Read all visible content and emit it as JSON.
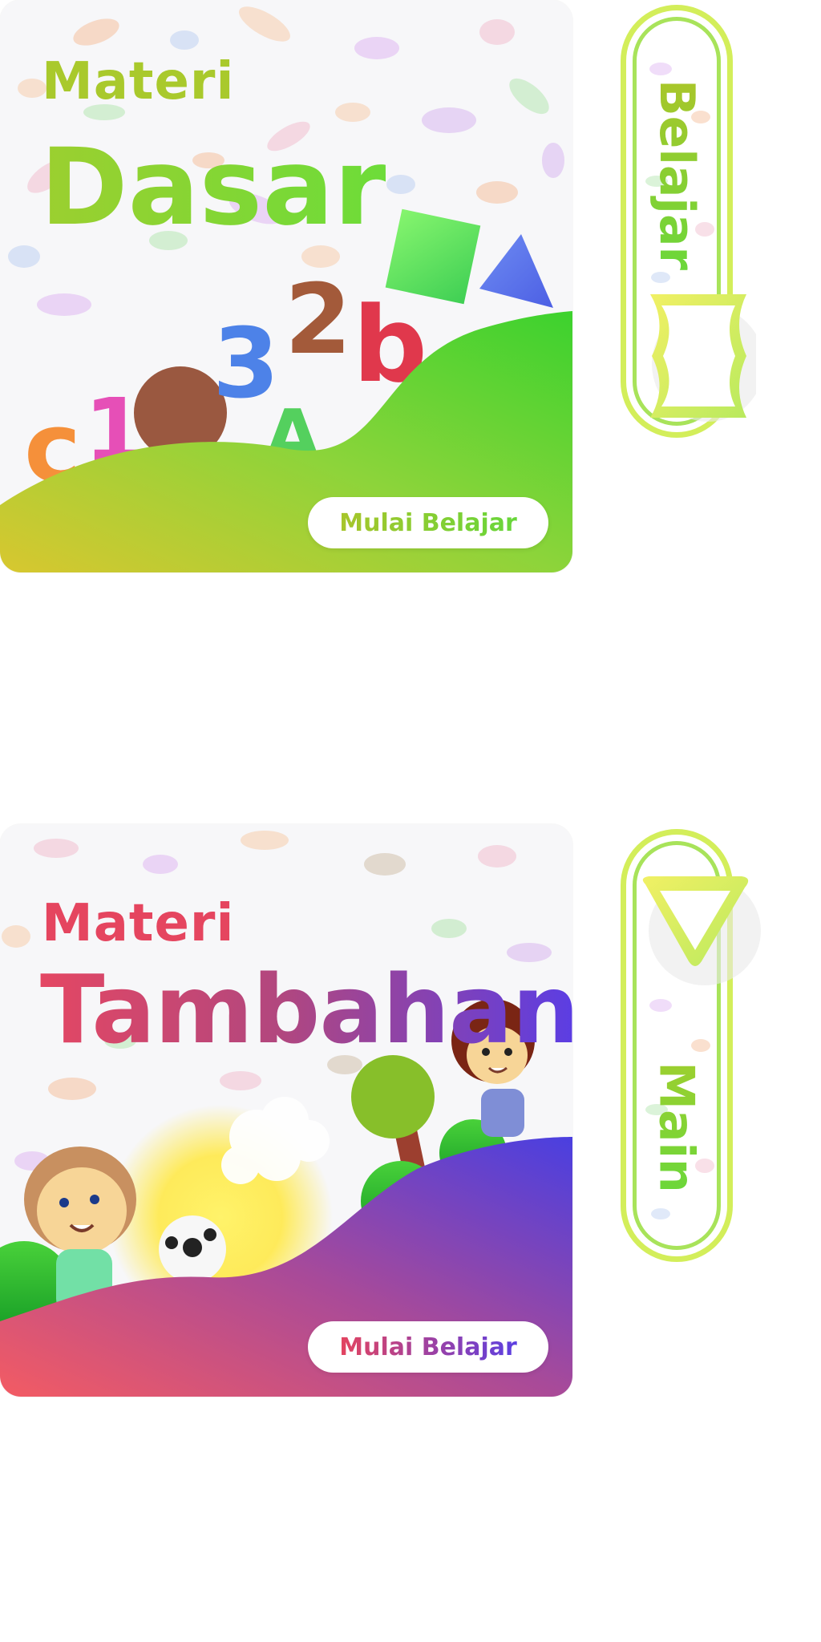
{
  "cards": [
    {
      "subtitle": "Materi",
      "title": "Dasar",
      "button_label": "Mulai Belajar",
      "decor_letters": [
        "c",
        "1",
        "3",
        "A",
        "2",
        "b"
      ]
    },
    {
      "subtitle": "Materi",
      "title": "Tambahan",
      "button_label": "Mulai Belajar"
    }
  ],
  "toggles": [
    {
      "label": "Belajar",
      "icon": "open-book-icon"
    },
    {
      "label": "Main",
      "icon": "play-icon"
    }
  ],
  "colors": {
    "green_accent": "#6ddc39",
    "lime_accent": "#d3ee5a",
    "pink_accent": "#e5455f",
    "purple_accent": "#5a3de5"
  }
}
